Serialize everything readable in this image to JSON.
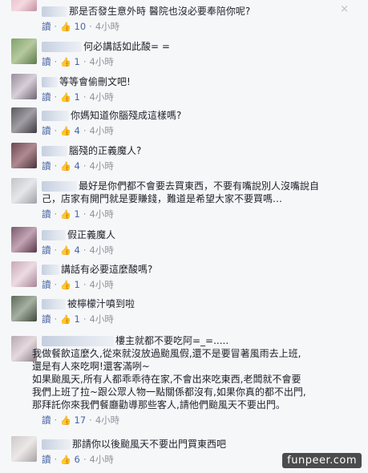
{
  "labels": {
    "read": "讀",
    "time_4h": "4小時",
    "close": "×",
    "watermark": "funpeer.com"
  },
  "comments": [
    {
      "text": "那是否發生意外時 醫院也沒必要奉陪你呢?",
      "likes": "10"
    },
    {
      "text": "何必講話如此酸= =",
      "likes": "1"
    },
    {
      "text": "等等會偷刪文吧!",
      "likes": "1"
    },
    {
      "text": "你媽知道你腦殘成這樣嗎?",
      "likes": "4"
    },
    {
      "text": "腦殘的正義魔人?",
      "likes": "4"
    },
    {
      "text": "最好是你們都不會要去買東西，不要有嘴說別人沒嘴說自己，店家有開門就是要賺錢，難道是希望大家不要買嗎…",
      "likes": "1"
    },
    {
      "text": "假正義魔人",
      "likes": "4"
    },
    {
      "text": "講話有必要這麼酸嗎?",
      "likes": "1"
    },
    {
      "text": "被檸檬汁噴到啦",
      "likes": "1"
    },
    {
      "text": "樓主就都不要吃阿=_=.....",
      "extra": [
        "我做餐飲這麼久,從來就沒放過颱風假,還不是要冒著風雨去上班,",
        "還是有人來吃啊!還客滿咧~",
        "如果颱風天,所有人都乖乖待在家,不會出來吃東西,老闆就不會要",
        "我們上班了拉~跟公眾人物一點關係都沒有,如果你真的都不出門,",
        "那拜託你來我們餐廳勸導那些客人,請他們颱風天不要出門。"
      ],
      "likes": "17"
    },
    {
      "text": "那請你以後颱風天不要出門買東西吧",
      "likes": "6"
    }
  ],
  "colors": {
    "link": "#4b67a1",
    "meta": "#90949c",
    "background": "#f6f7f9"
  }
}
